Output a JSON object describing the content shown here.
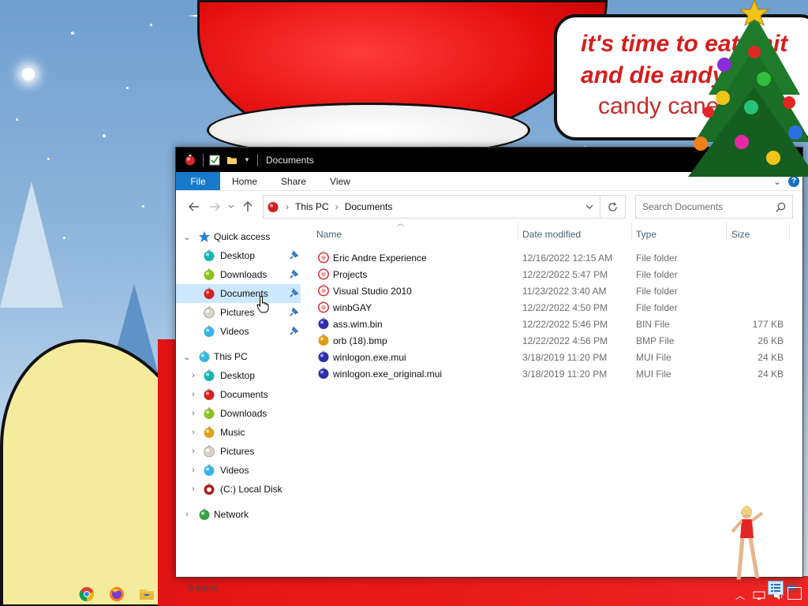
{
  "wallpaper": {
    "speech_line1": "it's time to eat shit",
    "speech_line2": "and die andy",
    "speech_line3": "candy cane"
  },
  "window": {
    "title": "Documents",
    "ribbon_tabs": [
      "File",
      "Home",
      "Share",
      "View"
    ],
    "help_label": "?",
    "address": {
      "crumbs": [
        "This PC",
        "Documents"
      ]
    },
    "search": {
      "placeholder": "Search Documents"
    },
    "sidebar": {
      "quick_access": {
        "label": "Quick access",
        "items": [
          {
            "label": "Desktop",
            "icon": "desktop-orb-icon"
          },
          {
            "label": "Downloads",
            "icon": "downloads-orb-icon"
          },
          {
            "label": "Documents",
            "icon": "documents-orb-icon",
            "selected": true
          },
          {
            "label": "Pictures",
            "icon": "pictures-orb-icon"
          },
          {
            "label": "Videos",
            "icon": "videos-orb-icon"
          }
        ]
      },
      "this_pc": {
        "label": "This PC",
        "items": [
          {
            "label": "Desktop"
          },
          {
            "label": "Documents"
          },
          {
            "label": "Downloads"
          },
          {
            "label": "Music"
          },
          {
            "label": "Pictures"
          },
          {
            "label": "Videos"
          },
          {
            "label": "(C:) Local Disk"
          }
        ]
      },
      "network": {
        "label": "Network"
      }
    },
    "columns": {
      "name": "Name",
      "date": "Date modified",
      "type": "Type",
      "size": "Size"
    },
    "files": [
      {
        "name": "Eric Andre Experience",
        "date": "12/16/2022 12:15 AM",
        "type": "File folder",
        "size": ""
      },
      {
        "name": "Projects",
        "date": "12/22/2022 5:47 PM",
        "type": "File folder",
        "size": ""
      },
      {
        "name": "Visual Studio 2010",
        "date": "11/23/2022 3:40 AM",
        "type": "File folder",
        "size": ""
      },
      {
        "name": "winbGAY",
        "date": "12/22/2022 4:50 PM",
        "type": "File folder",
        "size": ""
      },
      {
        "name": "ass.wim.bin",
        "date": "12/22/2022 5:46 PM",
        "type": "BIN File",
        "size": "177 KB"
      },
      {
        "name": "orb (18).bmp",
        "date": "12/22/2022 4:56 PM",
        "type": "BMP File",
        "size": "26 KB"
      },
      {
        "name": "winlogon.exe.mui",
        "date": "3/18/2019 11:20 PM",
        "type": "MUI File",
        "size": "24 KB"
      },
      {
        "name": "winlogon.exe_original.mui",
        "date": "3/18/2019 11:20 PM",
        "type": "MUI File",
        "size": "24 KB"
      }
    ],
    "status": {
      "item_count": "8 items"
    }
  },
  "colors": {
    "file_tab": "#1979ca",
    "selection": "#cce8ff",
    "titlebar": "#000000",
    "header_text": "#4c607a"
  }
}
